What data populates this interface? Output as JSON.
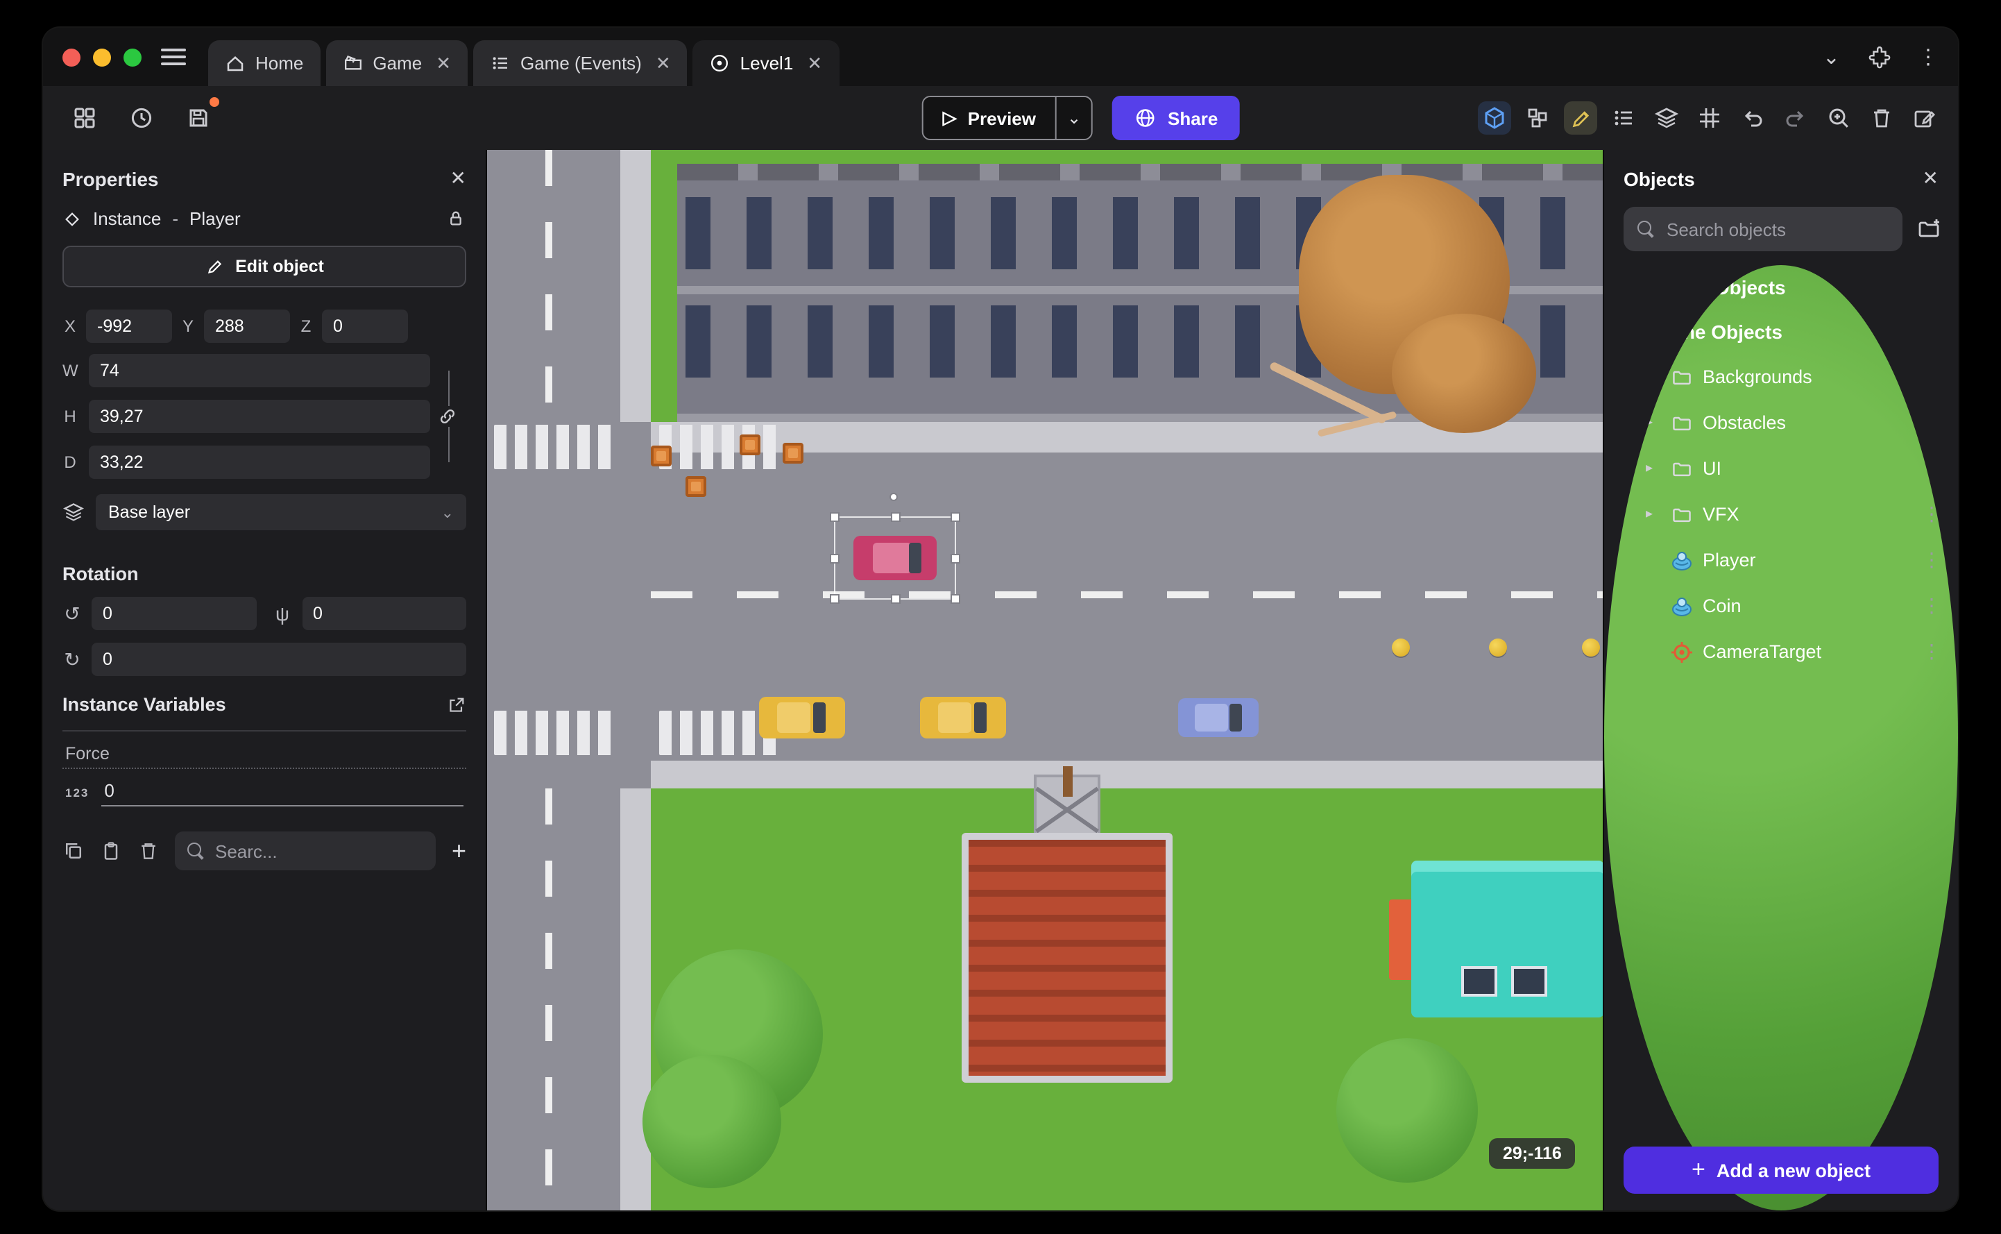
{
  "window": {
    "titlebar": {
      "tabs": [
        {
          "label": "Home"
        },
        {
          "label": "Game"
        },
        {
          "label": "Game (Events)"
        },
        {
          "label": "Level1"
        }
      ]
    },
    "toolbar": {
      "preview_label": "Preview",
      "share_label": "Share"
    }
  },
  "properties_panel": {
    "title": "Properties",
    "instance": {
      "type_label": "Instance",
      "separator": "-",
      "name": "Player"
    },
    "edit_object_label": "Edit object",
    "position": {
      "x_label": "X",
      "x": "-992",
      "y_label": "Y",
      "y": "288",
      "z_label": "Z",
      "z": "0"
    },
    "size": {
      "w_label": "W",
      "w": "74",
      "h_label": "H",
      "h": "39,27",
      "d_label": "D",
      "d": "33,22"
    },
    "layer": {
      "value": "Base layer"
    },
    "rotation": {
      "title": "Rotation",
      "rx": "0",
      "ry": "0",
      "rz": "0"
    },
    "instance_variables": {
      "title": "Instance Variables",
      "rows": [
        {
          "name": "Force",
          "type": "123",
          "value": "0"
        }
      ]
    },
    "search_placeholder": "Searc..."
  },
  "objects_panel": {
    "title": "Objects",
    "search_placeholder": "Search objects",
    "groups": [
      {
        "label": "Global Objects"
      },
      {
        "label": "Scene Objects"
      }
    ],
    "folders": [
      "Backgrounds",
      "Obstacles",
      "UI",
      "VFX"
    ],
    "objects": [
      {
        "name": "Player"
      },
      {
        "name": "Coin"
      },
      {
        "name": "CameraTarget"
      }
    ],
    "add_button_label": "Add a new object"
  },
  "scene": {
    "coords_badge": "29;-116"
  },
  "glyphs": {
    "close": "✕",
    "kebab": "⋮",
    "plus": "+",
    "chevron_down": "⌄",
    "caret_right": "▸",
    "caret_down": "▾",
    "play": "▷",
    "rotate_x": "↺",
    "rotate_y": "ψ",
    "rotate_z": "↻"
  },
  "colors": {
    "accent": "#5640ea",
    "selection": "#ffffff",
    "save_badge": "#ff7a45"
  }
}
